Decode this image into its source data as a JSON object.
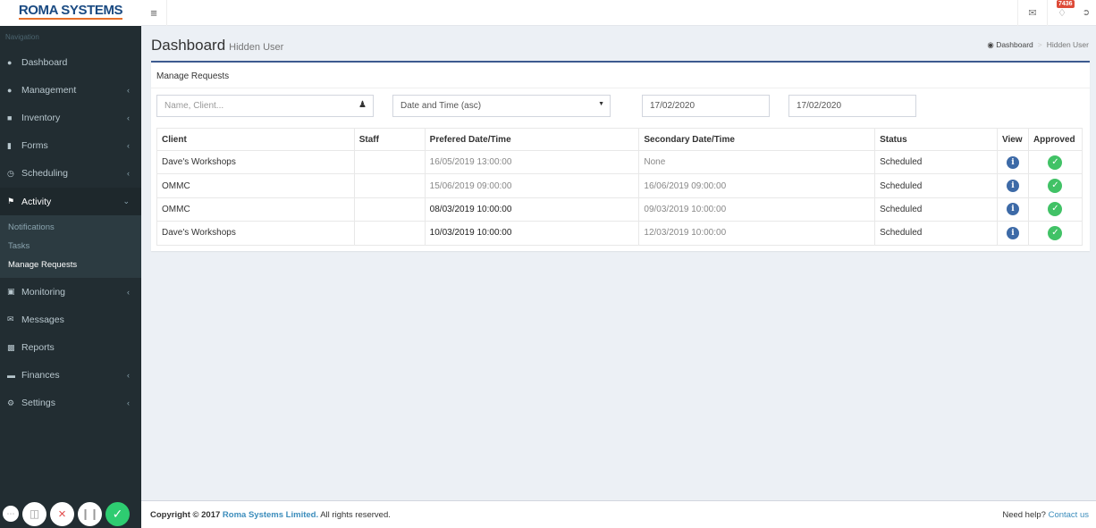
{
  "brand": {
    "name": "ROMA SYSTEMS"
  },
  "topbar": {
    "menu_icon": "hamburger-icon",
    "notification_count": "7436"
  },
  "sidebar": {
    "header": "Navigation",
    "items": [
      {
        "label": "Dashboard",
        "icon": "dashboard-icon"
      },
      {
        "label": "Management",
        "icon": "circle-icon"
      },
      {
        "label": "Inventory",
        "icon": "inventory-icon"
      },
      {
        "label": "Forms",
        "icon": "file-icon"
      },
      {
        "label": "Scheduling",
        "icon": "clock-icon"
      },
      {
        "label": "Activity",
        "icon": "bullhorn-icon"
      },
      {
        "label": "Monitoring",
        "icon": "map-icon"
      },
      {
        "label": "Messages",
        "icon": "envelope-icon"
      },
      {
        "label": "Reports",
        "icon": "bar-chart-icon"
      },
      {
        "label": "Finances",
        "icon": "money-icon"
      },
      {
        "label": "Settings",
        "icon": "gear-icon"
      }
    ],
    "activity_sub": [
      "Notifications",
      "Tasks",
      "Manage Requests"
    ]
  },
  "header": {
    "title": "Dashboard",
    "subtitle": "Hidden User",
    "breadcrumb": [
      "Dashboard",
      "Hidden User"
    ]
  },
  "panel": {
    "title": "Manage Requests",
    "filters": {
      "name_placeholder": "Name, Client...",
      "sort_value": "Date and Time (asc)",
      "date_from": "17/02/2020",
      "date_to": "17/02/2020"
    },
    "columns": [
      "Client",
      "Staff",
      "Prefered Date/Time",
      "Secondary Date/Time",
      "Status",
      "View",
      "Approved"
    ],
    "rows": [
      {
        "client": "Dave's Workshops",
        "staff": "",
        "preferred": "16/05/2019 13:00:00",
        "secondary": "None",
        "status": "Scheduled"
      },
      {
        "client": "OMMC",
        "staff": "",
        "preferred": "15/06/2019 09:00:00",
        "secondary": "16/06/2019 09:00:00",
        "status": "Scheduled"
      },
      {
        "client": "OMMC",
        "staff": "",
        "preferred": "08/03/2019 10:00:00",
        "secondary": "09/03/2019 10:00:00",
        "status": "Scheduled"
      },
      {
        "client": "Dave's Workshops",
        "staff": "",
        "preferred": "10/03/2019 10:00:00",
        "secondary": "12/03/2019 10:00:00",
        "status": "Scheduled"
      }
    ]
  },
  "footer": {
    "copyright_prefix": "Copyright © 2017",
    "company": "Roma Systems Limited.",
    "rights": "All rights reserved.",
    "help_text": "Need help?",
    "contact_link": "Contact us"
  },
  "colors": {
    "sidebar_bg": "#222d32",
    "accent": "#3c5a8f",
    "link": "#3c8dbc",
    "approved": "#41c266",
    "info": "#3d6aa7"
  }
}
